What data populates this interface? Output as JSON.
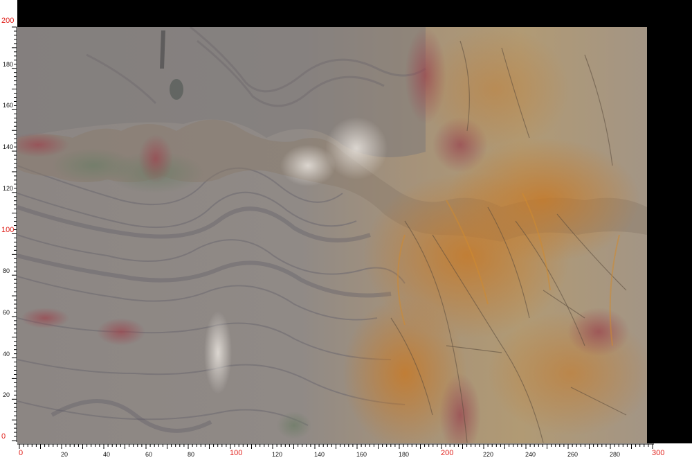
{
  "image": {
    "subject": "marble-slab-photo",
    "background_color": "#000000",
    "ruler_color": "#000000",
    "major_label_color": "#e0201a"
  },
  "ruler_vertical": {
    "unit_labels": [
      "0",
      "20",
      "40",
      "60",
      "80",
      "100",
      "120",
      "140",
      "160",
      "180",
      "200"
    ],
    "major_labels": [
      "0",
      "100",
      "200"
    ]
  },
  "ruler_horizontal": {
    "unit_labels": [
      "0",
      "20",
      "40",
      "60",
      "80",
      "100",
      "120",
      "140",
      "160",
      "180",
      "200",
      "220",
      "240",
      "260",
      "280",
      "300"
    ],
    "major_labels": [
      "0",
      "100",
      "200",
      "300"
    ]
  }
}
